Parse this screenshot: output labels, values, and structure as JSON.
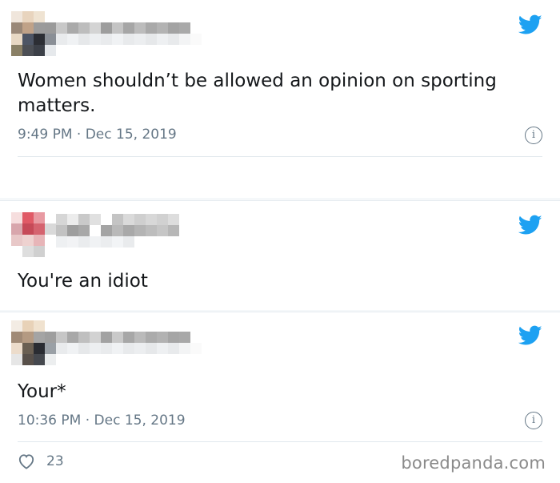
{
  "colors": {
    "twitter_blue": "#1da1f2",
    "meta_gray": "#657786",
    "divider": "#e1e8ed"
  },
  "tweets": [
    {
      "text": "Women shouldn’t be allowed an opinion on sporting matters.",
      "time": "9:49 PM",
      "date": "Dec 15, 2019"
    },
    {
      "text": "You're an idiot"
    },
    {
      "text": "Your*",
      "time": "10:36 PM",
      "date": "Dec 15, 2019",
      "likes": "23"
    }
  ],
  "separator": "·",
  "info_glyph": "i",
  "watermark": "boredpanda.com",
  "icons": {
    "brand": "twitter-bird-icon",
    "info": "info-icon",
    "like": "heart-icon"
  }
}
